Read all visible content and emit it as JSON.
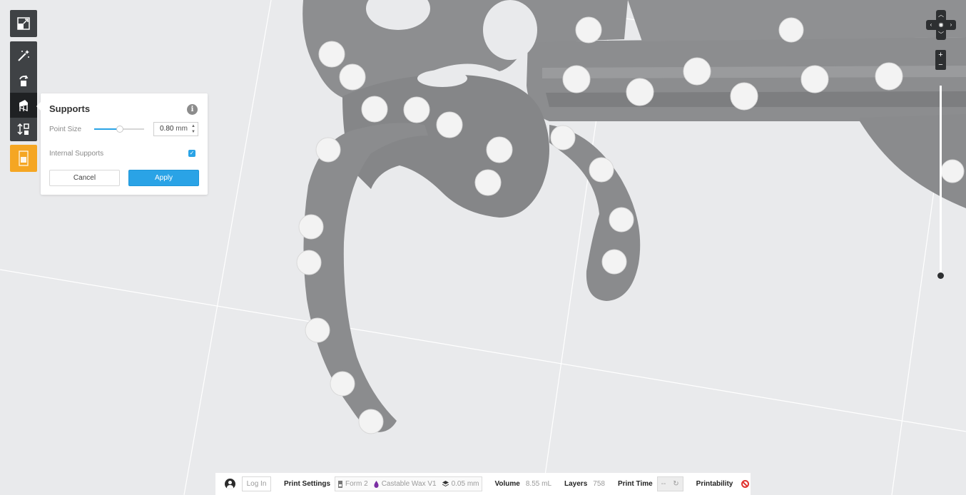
{
  "toolbar": {
    "tools": [
      {
        "name": "orientation",
        "icon": "resize-frame-icon"
      },
      {
        "name": "magic-wand",
        "icon": "magic-wand-icon"
      },
      {
        "name": "rotate",
        "icon": "rotate-icon"
      },
      {
        "name": "supports",
        "icon": "supports-icon",
        "active": true
      },
      {
        "name": "layout",
        "icon": "layout-arrange-icon"
      },
      {
        "name": "print",
        "icon": "printer-tray-icon"
      }
    ]
  },
  "supports_panel": {
    "title": "Supports",
    "point_size_label": "Point Size",
    "point_size_value": "0.80",
    "point_size_unit": "mm",
    "point_size_fraction": 0.52,
    "internal_supports_label": "Internal Supports",
    "internal_supports_checked": true,
    "cancel_label": "Cancel",
    "apply_label": "Apply"
  },
  "status_bar": {
    "login_label": "Log In",
    "print_settings_label": "Print Settings",
    "printer": "Form 2",
    "material": "Castable Wax V1",
    "layer_thickness": "0.05 mm",
    "volume_label": "Volume",
    "volume_value": "8.55 mL",
    "layers_label": "Layers",
    "layers_value": "758",
    "print_time_label": "Print Time",
    "print_time_value": "--",
    "printability_label": "Printability"
  },
  "colors": {
    "accent": "#2aa3e6",
    "toolbar_bg": "#3f4245",
    "print_button": "#f5a623",
    "error": "#e0332f",
    "model_gray": "#8a8b8d",
    "support_point": "#f2f2f2"
  }
}
